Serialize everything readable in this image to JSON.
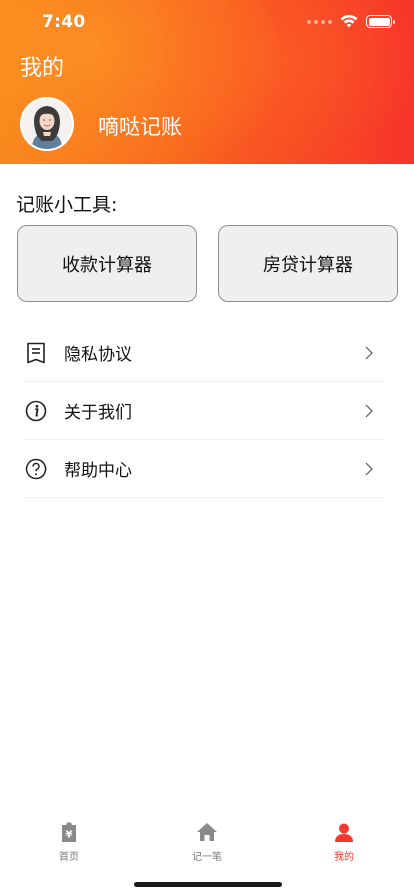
{
  "status_bar": {
    "time": "7:40"
  },
  "header": {
    "title": "我的",
    "app_name": "嘀哒记账",
    "gradient_colors": [
      "#f7891e",
      "#f7332a"
    ]
  },
  "tools": {
    "title": "记账小工具:",
    "buttons": [
      {
        "label": "收款计算器"
      },
      {
        "label": "房贷计算器"
      }
    ]
  },
  "menu": {
    "items": [
      {
        "label": "隐私协议",
        "icon": "document-icon"
      },
      {
        "label": "关于我们",
        "icon": "info-icon"
      },
      {
        "label": "帮助中心",
        "icon": "help-icon"
      }
    ]
  },
  "tabbar": {
    "items": [
      {
        "label": "首页",
        "icon": "yen-tag-icon",
        "active": false
      },
      {
        "label": "记一笔",
        "icon": "home-icon",
        "active": false
      },
      {
        "label": "我的",
        "icon": "person-icon",
        "active": true
      }
    ],
    "active_color": "#f23a2c",
    "inactive_color": "#7a7a7a"
  }
}
